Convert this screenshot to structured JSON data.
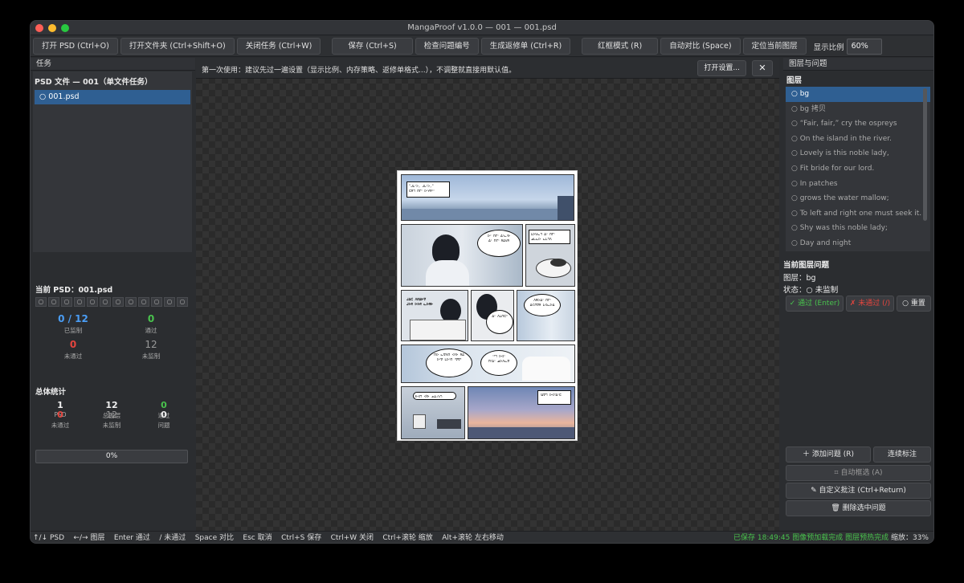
{
  "window": {
    "title": "MangaProof v1.0.0 — 001 — 001.psd"
  },
  "toolbar": {
    "open_psd": "打开 PSD (Ctrl+O)",
    "open_folder": "打开文件夹 (Ctrl+Shift+O)",
    "close_task": "关闭任务 (Ctrl+W)",
    "save": "保存 (Ctrl+S)",
    "check_numbers": "检查问题编号",
    "gen_sheet": "生成返修单 (Ctrl+R)",
    "red_mode": "红框模式 (R)",
    "auto_compare": "自动对比 (Space)",
    "locate_layer": "定位当前图层",
    "zoom_label": "显示比例",
    "zoom_value": "60%"
  },
  "left": {
    "tasks_header": "任务",
    "task_title": "PSD 文件 — 001（单文件任务）",
    "task_item": "○ 001.psd",
    "current_psd": "当前 PSD：001.psd",
    "dots": [
      "○",
      "○",
      "○",
      "○",
      "○",
      "○",
      "○",
      "○",
      "○",
      "○",
      "○",
      "○"
    ],
    "stats": {
      "reviewed_value": "0 / 12",
      "reviewed_label": "已监制",
      "pass_value": "0",
      "pass_label": "通过",
      "fail_value": "0",
      "fail_label": "未通过",
      "unreviewed_value": "12",
      "unreviewed_label": "未监制"
    },
    "total_header": "总体统计",
    "total": {
      "psd_value": "1",
      "psd_label": "PSD",
      "layers_value": "12",
      "layers_label": "总图层",
      "pass_value": "0",
      "pass_label": "通过",
      "fail_value": "0",
      "fail_label": "未通过",
      "unrev_value": "12",
      "unrev_label": "未监制",
      "issues_value": "0",
      "issues_label": "问题"
    },
    "progress_text": "0%",
    "progress": 0
  },
  "center": {
    "notice": "第一次使用：建议先过一遍设置（显示比例、内存策略、返修单格式...），不调整就直接用默认值。",
    "open_settings": "打开设置...",
    "close": "✕"
  },
  "right": {
    "header": "图层与问题",
    "layers_label": "图层",
    "layers": [
      "○ bg",
      "○ bg 拷贝",
      "○ “Fair, fair,” cry the ospreys",
      "○ On the island  in the river.",
      "○ Lovely is this  noble lady,",
      "○ Fit bride  for our lord.",
      "○ In patches",
      "○ grows the  water mallow;",
      "○ To left and right  one must seek it.",
      "○ Shy was  this noble lady;",
      "○ Day and night"
    ],
    "issue_header": "当前图层问题",
    "layer_line": "图层：bg",
    "status_line": "状态：○ 未监制",
    "pass_btn": "✓ 通过 (Enter)",
    "fail_btn": "✗ 未通过 (/)",
    "reset_btn": "○ 重置",
    "add_issue": "＋ 添加问题 (R)",
    "continuous": "连续标注",
    "auto_select": "⌗ 自动框选 (A)",
    "custom_note": "✎ 自定义批注 (Ctrl+Return)",
    "delete_issue": "🗑 删除选中问题"
  },
  "status": {
    "left": "↑/↓ PSD    ←/→ 图层    Enter 通过    / 未通过    Space 对比    Esc 取消    Ctrl+S 保存    Ctrl+W 关闭    Ctrl+滚轮 缩放    Alt+滚轮 左右移动",
    "saved": "已保存 18:49:45",
    "preload": "图像预加载完成",
    "layer_preheat": "图层预热完成",
    "zoom": "缩放：33%"
  },
  "colors": {
    "accent": "#2f5f92",
    "pass": "#49c34d",
    "fail": "#e5453e",
    "info": "#4a9df5"
  }
}
